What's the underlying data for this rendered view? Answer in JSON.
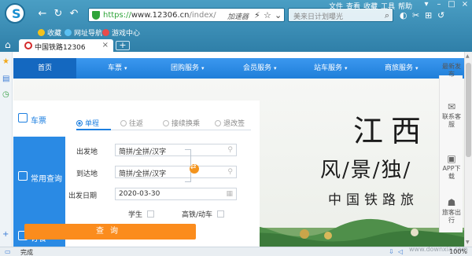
{
  "browser": {
    "url_scheme": "https://",
    "url_host": "www.12306.cn",
    "url_path": "/index/",
    "accelerate_label": "加速器",
    "search_placeholder": "美来日计划曝光",
    "menu": [
      "文件",
      "查看",
      "收藏",
      "工具",
      "帮助"
    ],
    "bookmarks": [
      "收藏",
      "网址导航",
      "游戏中心"
    ],
    "tab_title": "中国铁路12306",
    "status": "完成",
    "zoom": "100%"
  },
  "nav": {
    "items": [
      {
        "label": "首页"
      },
      {
        "label": "车票"
      },
      {
        "label": "团购服务"
      },
      {
        "label": "会员服务"
      },
      {
        "label": "站车服务"
      },
      {
        "label": "商旅服务"
      }
    ]
  },
  "sidebar_tabs": [
    {
      "label": "车票"
    },
    {
      "label": "常用查询"
    },
    {
      "label": "订餐"
    }
  ],
  "form": {
    "tabs": [
      "单程",
      "往返",
      "接续换乘",
      "退改签"
    ],
    "from_label": "出发地",
    "from_value": "简拼/全拼/汉字",
    "to_label": "到达地",
    "to_value": "简拼/全拼/汉字",
    "date_label": "出发日期",
    "date_value": "2020-03-30",
    "student_label": "学生",
    "highspeed_label": "高铁/动车",
    "query_label": "查询"
  },
  "hero": {
    "line1": "江西",
    "line2": "风/景/独/",
    "line3": "中国铁路旅"
  },
  "right_panel": [
    {
      "label": "最新发布"
    },
    {
      "label": "联系客服"
    },
    {
      "label": "APP下载"
    },
    {
      "label": "旅客出行"
    }
  ],
  "watermark": "www.downxia.com"
}
